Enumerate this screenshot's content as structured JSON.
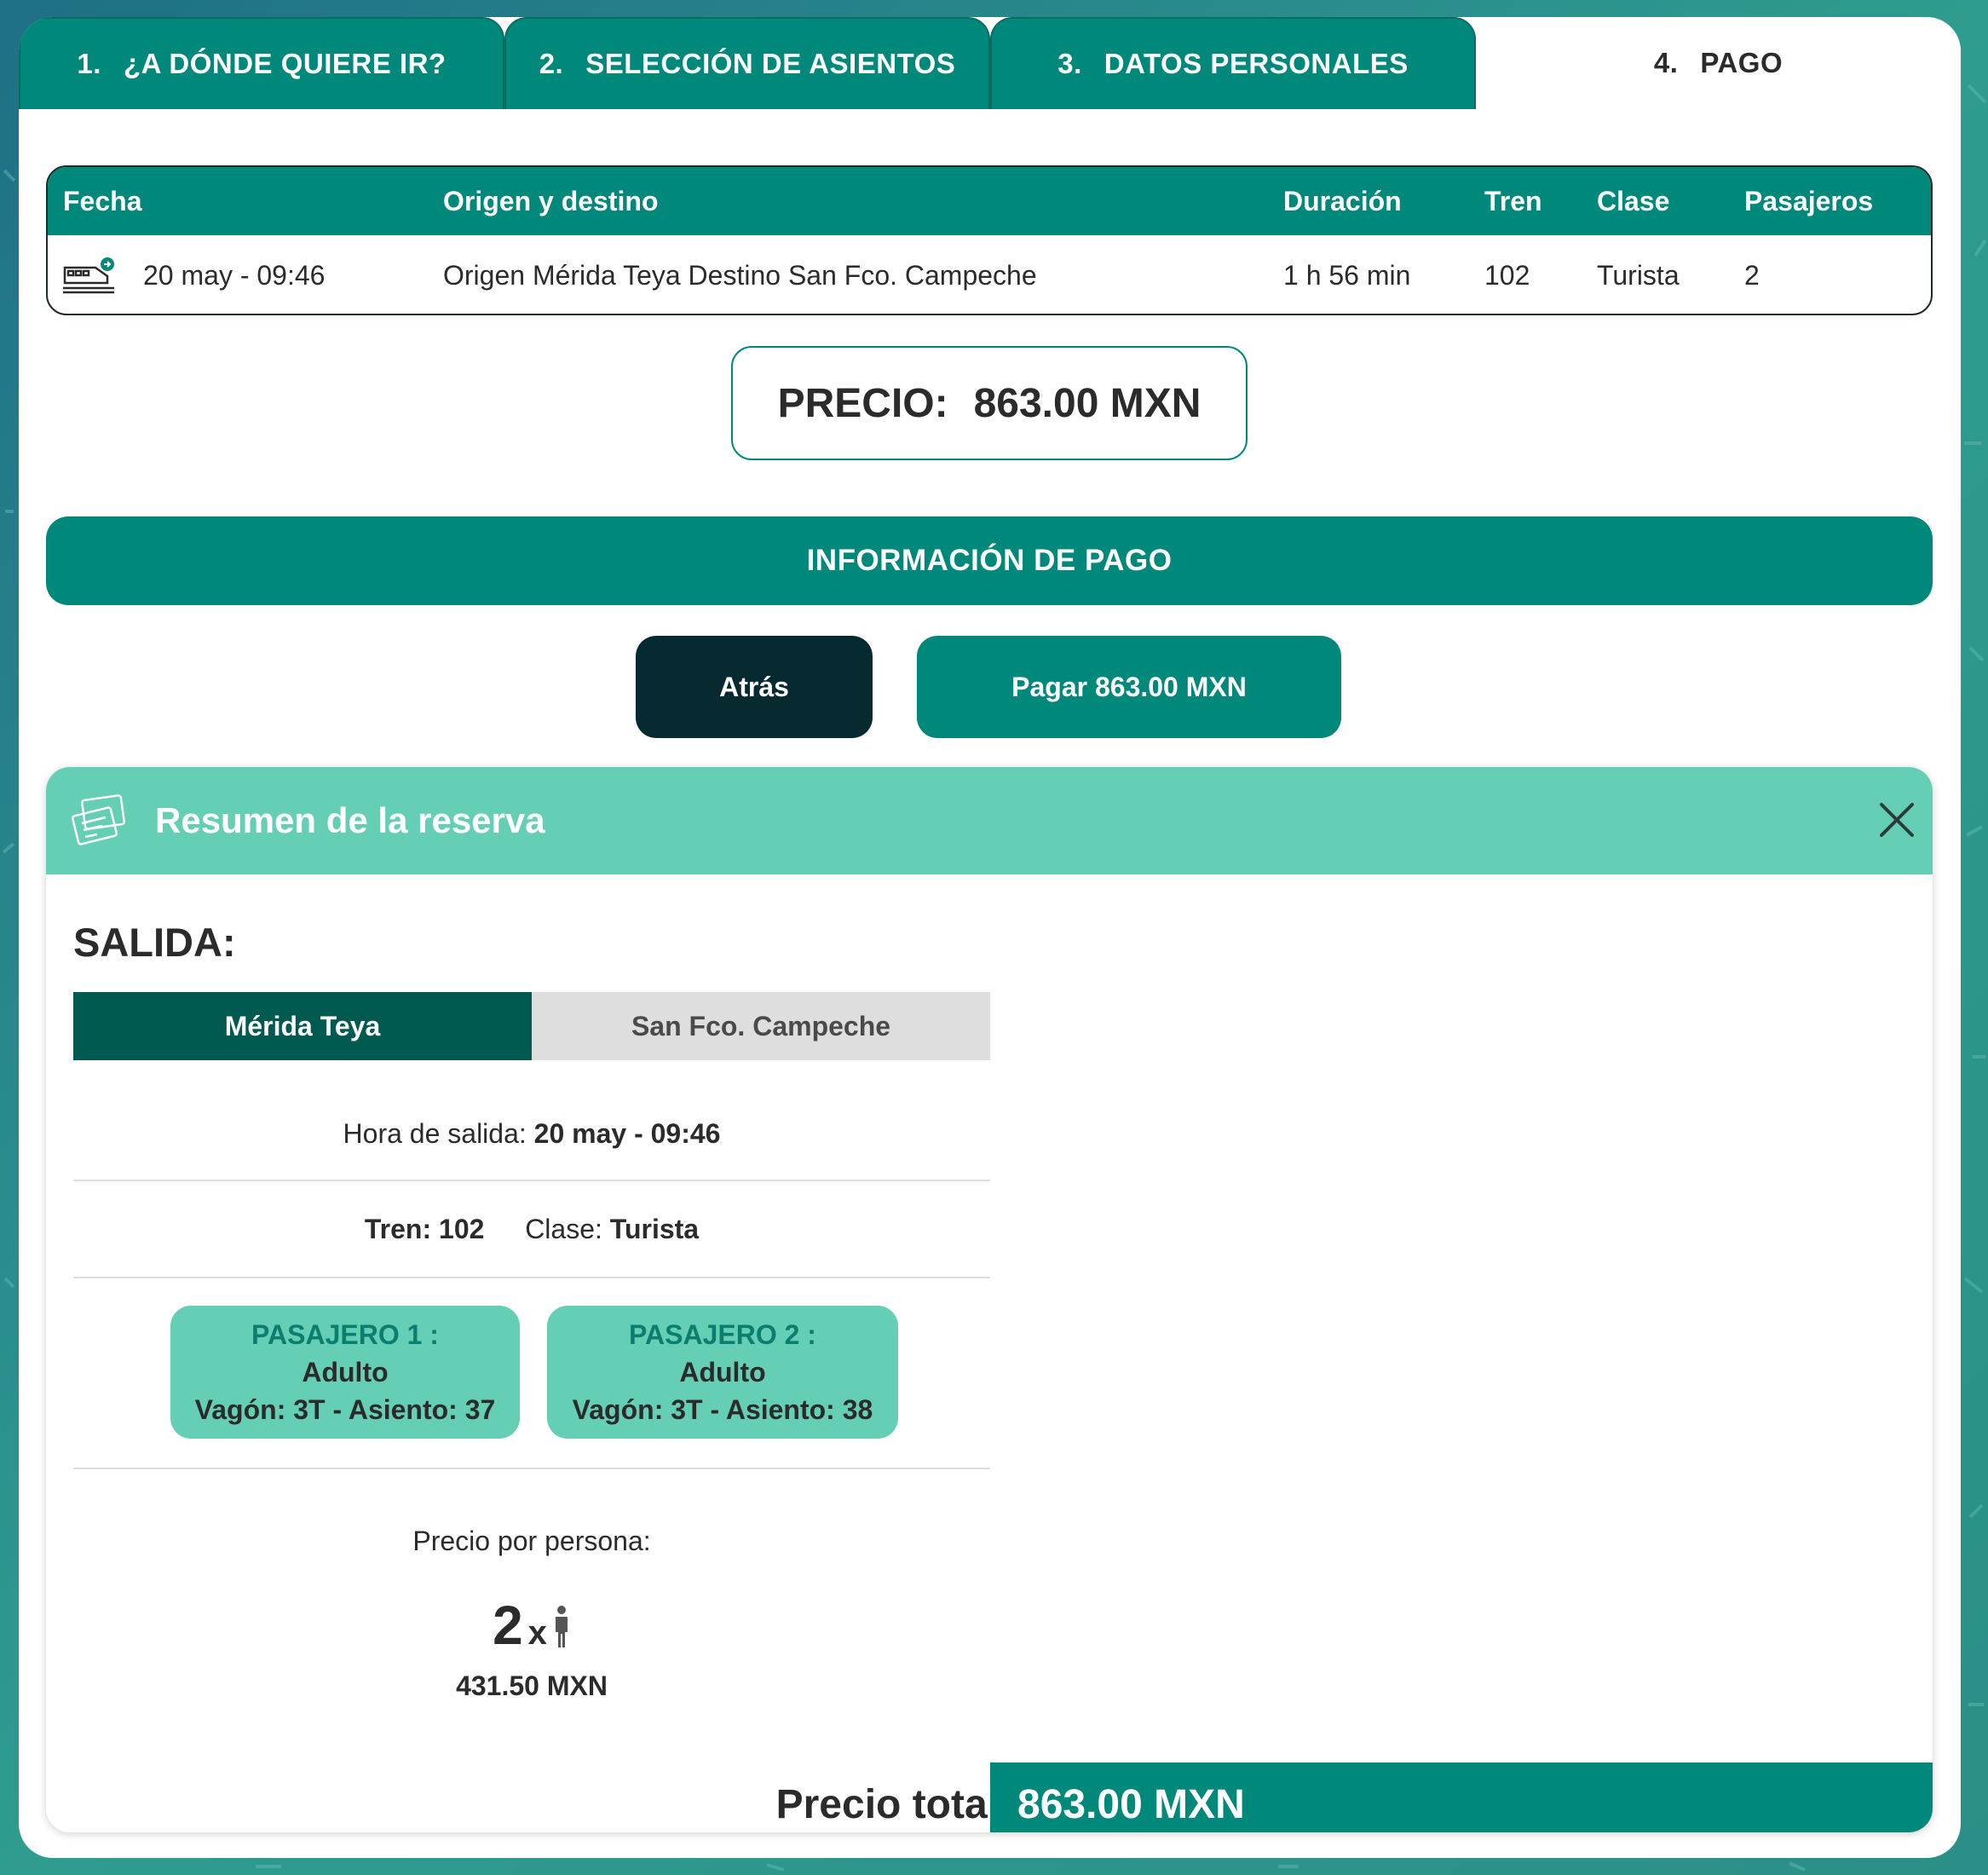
{
  "colors": {
    "primary": "#00897b",
    "mint": "#65cfb5",
    "dark_teal": "#005a50",
    "back_button": "#062a30"
  },
  "tabs": [
    {
      "num": "1.",
      "label": "¿A DÓNDE QUIERE IR?"
    },
    {
      "num": "2.",
      "label": "SELECCIÓN DE ASIENTOS"
    },
    {
      "num": "3.",
      "label": "DATOS PERSONALES"
    },
    {
      "num": "4.",
      "label": "PAGO",
      "active": true
    }
  ],
  "trip": {
    "headers": [
      "Fecha",
      "Origen y destino",
      "Duración",
      "Tren",
      "Clase",
      "Pasajeros"
    ],
    "row": {
      "icon": "train-icon",
      "fecha": "20 may - 09:46",
      "origen_destino": "Origen Mérida Teya Destino San Fco. Campeche",
      "duracion": "1 h 56 min",
      "tren": "102",
      "clase": "Turista",
      "pasajeros": "2"
    }
  },
  "price": {
    "label": "PRECIO:",
    "value": "863.00 MXN"
  },
  "info_bar": "INFORMACIÓN DE PAGO",
  "buttons": {
    "back": "Atrás",
    "pay": "Pagar 863.00 MXN"
  },
  "summary": {
    "icon": "ticket-icon",
    "title": "Resumen de la reserva",
    "close_icon": "close-icon",
    "salida": "SALIDA:",
    "origin": "Mérida Teya",
    "destination": "San Fco. Campeche",
    "hora_label": "Hora de salida:",
    "hora_value": "20 may - 09:46",
    "tren_label": "Tren: 102",
    "clase_label": "Clase:",
    "clase_value": "Turista",
    "passengers": [
      {
        "title": "PASAJERO 1 :",
        "type": "Adulto",
        "seat": "Vagón: 3T - Asiento: 37"
      },
      {
        "title": "PASAJERO 2 :",
        "type": "Adulto",
        "seat": "Vagón: 3T - Asiento: 38"
      }
    ],
    "precio_persona_label": "Precio por persona:",
    "qty": "2",
    "qty_x": "x",
    "person_icon": "person-icon",
    "per_person_price": "431.50 MXN",
    "total_label": "Precio total:",
    "total_value": "863.00 MXN"
  }
}
